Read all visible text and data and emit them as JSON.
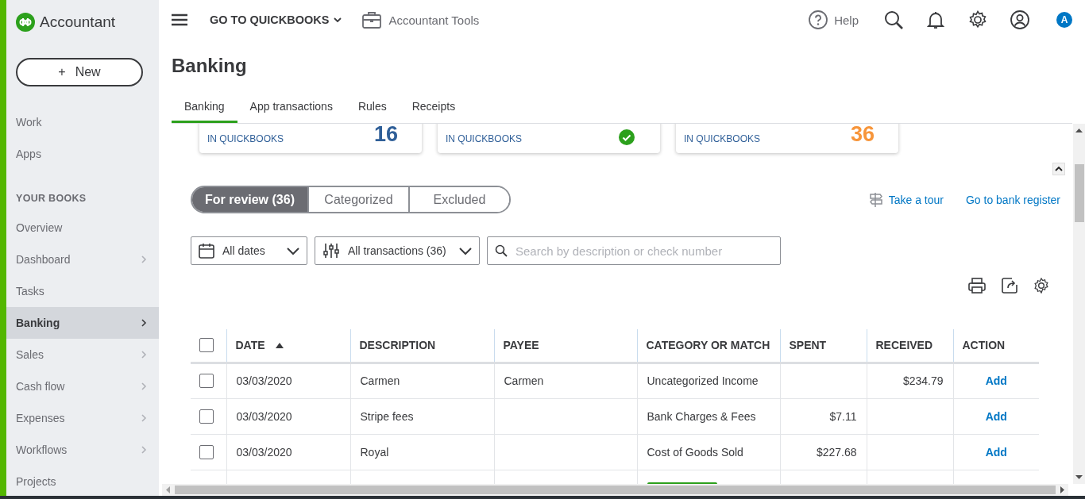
{
  "sidebar": {
    "logo": "Accountant",
    "new_button": {
      "icon": "+",
      "label": "New"
    },
    "top_items": [
      {
        "label": "Work",
        "expandable": false,
        "selected": false
      },
      {
        "label": "Apps",
        "expandable": false,
        "selected": false
      }
    ],
    "section": {
      "heading": "YOUR BOOKS",
      "items": [
        {
          "label": "Overview",
          "expandable": false,
          "selected": false
        },
        {
          "label": "Dashboard",
          "expandable": true,
          "selected": false
        },
        {
          "label": "Tasks",
          "expandable": false,
          "selected": false
        },
        {
          "label": "Banking",
          "expandable": true,
          "selected": true
        },
        {
          "label": "Sales",
          "expandable": true,
          "selected": false
        },
        {
          "label": "Cash flow",
          "expandable": true,
          "selected": false
        },
        {
          "label": "Expenses",
          "expandable": true,
          "selected": false
        },
        {
          "label": "Workflows",
          "expandable": true,
          "selected": false
        },
        {
          "label": "Projects",
          "expandable": false,
          "selected": false
        }
      ]
    }
  },
  "topbar": {
    "menu": "GO TO QUICKBOOKS",
    "tools": "Accountant Tools",
    "help": "Help",
    "avatar": "A"
  },
  "page": {
    "title": "Banking",
    "tabs": [
      {
        "label": "Banking",
        "selected": true
      },
      {
        "label": "App transactions",
        "selected": false
      },
      {
        "label": "Rules",
        "selected": false
      },
      {
        "label": "Receipts",
        "selected": false
      }
    ],
    "accounts": [
      {
        "kind": "count",
        "label": "IN QUICKBOOKS",
        "count": "16",
        "color": "#2f5f98"
      },
      {
        "kind": "check",
        "label": "IN QUICKBOOKS"
      },
      {
        "kind": "count",
        "label": "IN QUICKBOOKS",
        "count": "36",
        "color": "#f7953a"
      }
    ],
    "segments": [
      {
        "label": "For review (36)",
        "selected": true
      },
      {
        "label": "Categorized",
        "selected": false
      },
      {
        "label": "Excluded",
        "selected": false
      }
    ],
    "links": [
      "Take a tour",
      "Go to bank register"
    ],
    "filters": {
      "dates": "All dates",
      "transactions": "All transactions (36)",
      "search": {
        "placeholder": "Search by description or check number"
      }
    },
    "table": {
      "select_all": {
        "checked": false
      },
      "columns": [
        {
          "label": "DATE",
          "sorted": true
        },
        {
          "label": "DESCRIPTION"
        },
        {
          "label": "PAYEE"
        },
        {
          "label": "CATEGORY OR MATCH"
        },
        {
          "label": "SPENT"
        },
        {
          "label": "RECEIVED"
        },
        {
          "label": "ACTION"
        }
      ],
      "rows": [
        {
          "kind": "transaction",
          "checked": false,
          "date": "03/03/2020",
          "description": "Carmen",
          "payee": "Carmen",
          "category": "Uncategorized Income",
          "spent": "",
          "received": "$234.79",
          "action": "Add"
        },
        {
          "kind": "transaction",
          "checked": false,
          "date": "03/03/2020",
          "description": "Stripe fees",
          "payee": "",
          "category": "Bank Charges & Fees",
          "spent": "$7.11",
          "received": "",
          "action": "Add"
        },
        {
          "kind": "transaction",
          "checked": false,
          "date": "03/03/2020",
          "description": "Royal",
          "payee": "",
          "category": "Cost of Goods Sold",
          "spent": "$227.68",
          "received": "",
          "action": "Add"
        },
        {
          "kind": "match"
        }
      ]
    }
  }
}
